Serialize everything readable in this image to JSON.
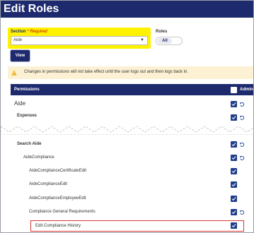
{
  "header": {
    "title": "Edit Roles"
  },
  "section": {
    "label": "Section",
    "required_text": "* Required",
    "selected": "Aide"
  },
  "roles": {
    "label": "Roles",
    "toggle": "All"
  },
  "view_button": {
    "label": "View"
  },
  "warning": {
    "text": "Changes in permissions will not take effect until the user logs out and then logs back in."
  },
  "permissions": {
    "header_label": "Permissions",
    "admin_label": "Admin",
    "rows": [
      {
        "label": "Aide",
        "checked": true,
        "undo": true
      },
      {
        "label": "Expenses",
        "checked": true,
        "undo": true
      },
      {
        "label": "Search Aide",
        "checked": true,
        "undo": true
      },
      {
        "label": "AideCompliance",
        "checked": true,
        "undo": true
      },
      {
        "label": "AideComplianceCertificateEdit",
        "checked": true,
        "undo": false
      },
      {
        "label": "AideComplianceEdit",
        "checked": true,
        "undo": false
      },
      {
        "label": "AideComplianceEmployeeEdit",
        "checked": true,
        "undo": false
      },
      {
        "label": "Compliance General Requirements",
        "checked": true,
        "undo": true
      },
      {
        "label": "Edit Compliance History",
        "checked": true,
        "undo": false
      }
    ]
  },
  "colors": {
    "header_bg": "#1e2a6e",
    "section_highlight": "#fff200",
    "checkbox": "#1f3e8c",
    "warning_bg": "#fdf1d4",
    "highlight_border": "#d93636"
  }
}
